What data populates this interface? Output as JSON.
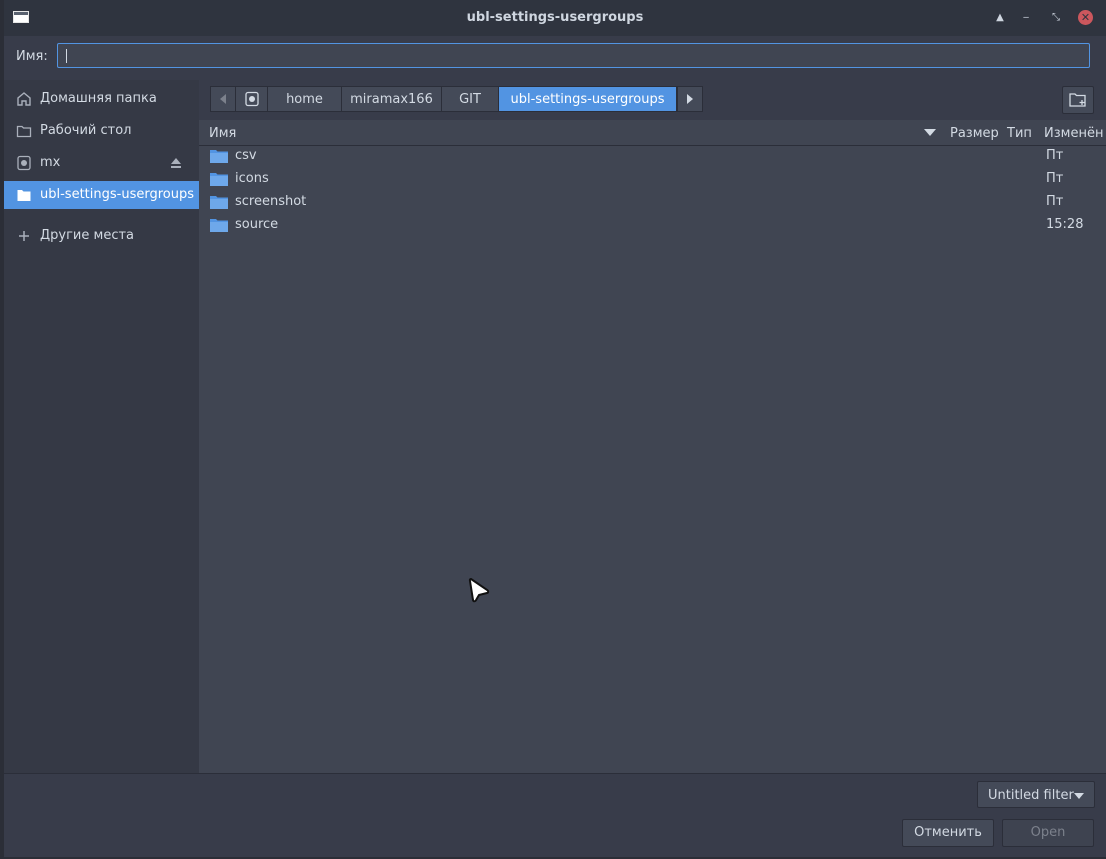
{
  "window": {
    "title": "ubl-settings-usergroups",
    "buttons": [
      "maximize-up",
      "minimize",
      "restore",
      "close"
    ]
  },
  "name_field": {
    "label": "Имя:",
    "value": "",
    "placeholder": ""
  },
  "sidebar": {
    "items": [
      {
        "label": "Домашняя папка",
        "icon": "home-icon"
      },
      {
        "label": "Рабочий стол",
        "icon": "folder-icon"
      },
      {
        "label": "mx",
        "icon": "drive-icon",
        "eject": true
      },
      {
        "label": "ubl-settings-usergroups",
        "icon": "folder-icon",
        "selected": true
      },
      {
        "label": "Другие места",
        "icon": "plus-icon"
      }
    ]
  },
  "pathbar": {
    "crumbs": [
      "home",
      "miramax166",
      "GIT",
      "ubl-settings-usergroups"
    ],
    "selected": "ubl-settings-usergroups"
  },
  "columns": {
    "name": "Имя",
    "size": "Размер",
    "type": "Тип",
    "modified": "Изменён"
  },
  "files": [
    {
      "name": "csv",
      "modified": "Пт"
    },
    {
      "name": "icons",
      "modified": "Пт"
    },
    {
      "name": "screenshot",
      "modified": "Пт"
    },
    {
      "name": "source",
      "modified": "15:28"
    }
  ],
  "filter": {
    "label": "Untitled filter"
  },
  "actions": {
    "cancel": "Отменить",
    "open": "Open"
  },
  "colors": {
    "accent": "#5294e2",
    "background": "#383c4a",
    "close": "#cc575d"
  }
}
